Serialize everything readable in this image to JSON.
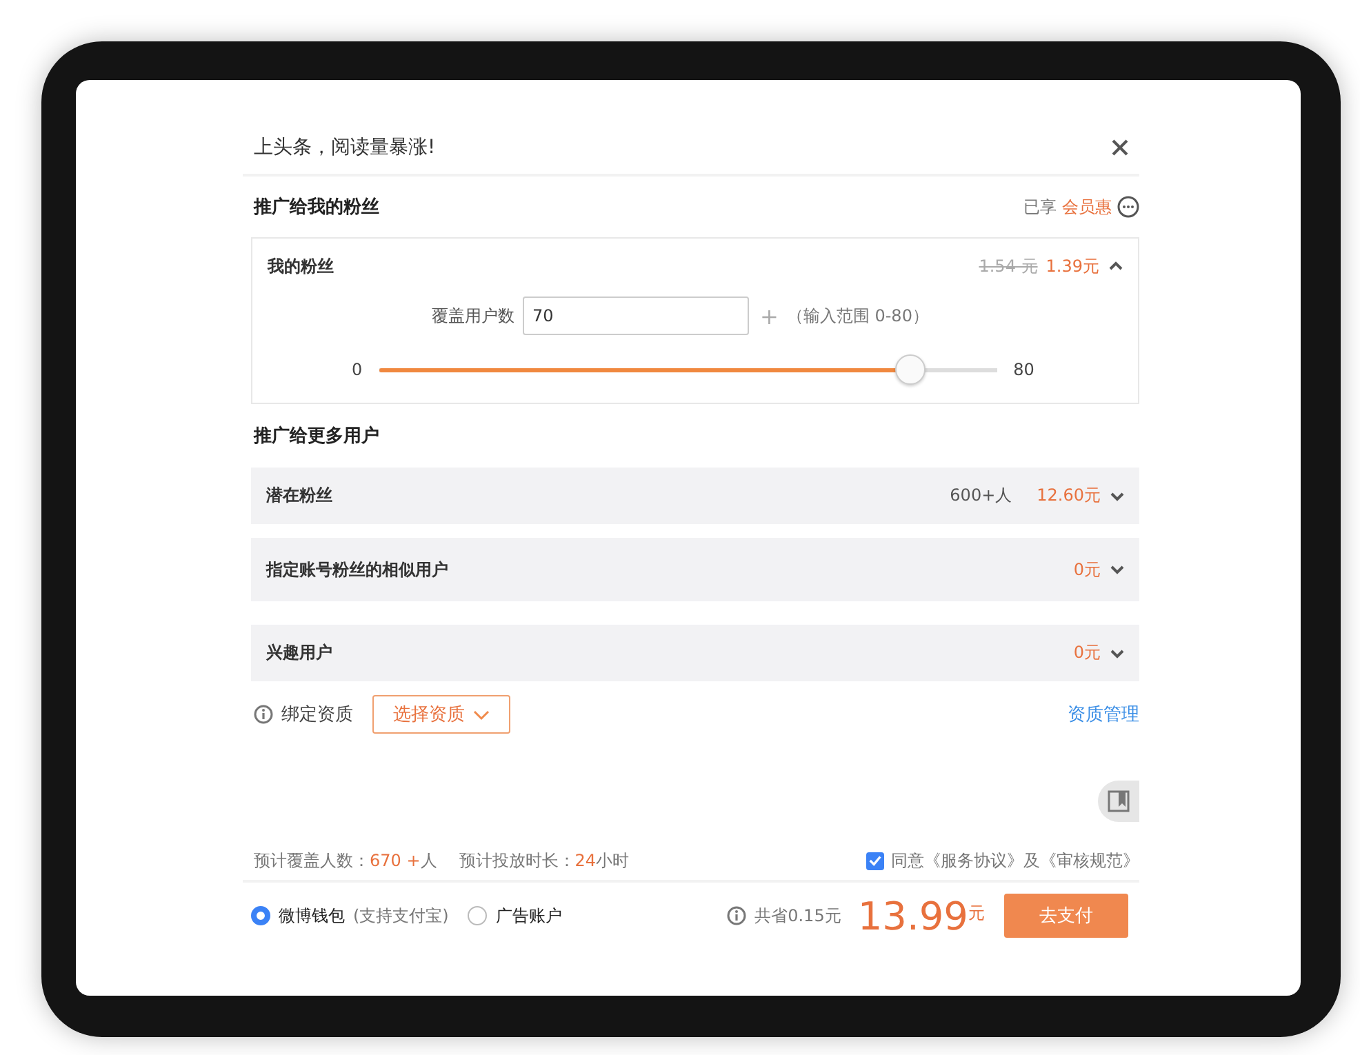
{
  "dialog": {
    "title": "上头条，阅读量暴涨!"
  },
  "my_fans": {
    "heading": "推广给我的粉丝",
    "perk_prefix": "已享",
    "perk": "会员惠",
    "card": {
      "label": "我的粉丝",
      "old_price": "1.54 元",
      "price": "1.39元",
      "expanded": true,
      "field_label": "覆盖用户数",
      "value": "70",
      "plus": "+",
      "range": "（输入范围 0-80）",
      "min": "0",
      "max": "80",
      "level": 0.86
    }
  },
  "more": {
    "heading": "推广给更多用户",
    "rows": [
      {
        "label": "潜在粉丝",
        "count": "600+人",
        "price": "12.60元",
        "expanded": false
      },
      {
        "label": "指定账号粉丝的相似用户",
        "price": "0元",
        "expanded": false
      },
      {
        "label": "兴趣用户",
        "price": "0元",
        "expanded": false
      }
    ]
  },
  "qualification": {
    "label": "绑定资质",
    "select": "选择资质",
    "manage": "资质管理"
  },
  "summary": {
    "coverage_label": "预计覆盖人数：",
    "coverage": "670 +",
    "coverage_unit": "人",
    "duration_label": "预计投放时长：",
    "duration": "24",
    "duration_unit": "小时",
    "agree": {
      "checked": true,
      "text": "同意《服务协议》及《审核规范》"
    }
  },
  "payment": {
    "methods": [
      {
        "label": "微博钱包",
        "note": "(支持支付宝)",
        "selected": true
      },
      {
        "label": "广告账户",
        "selected": false
      }
    ],
    "savings": "共省0.15元",
    "total": "13.99",
    "currency": "元",
    "pay": "去支付"
  }
}
